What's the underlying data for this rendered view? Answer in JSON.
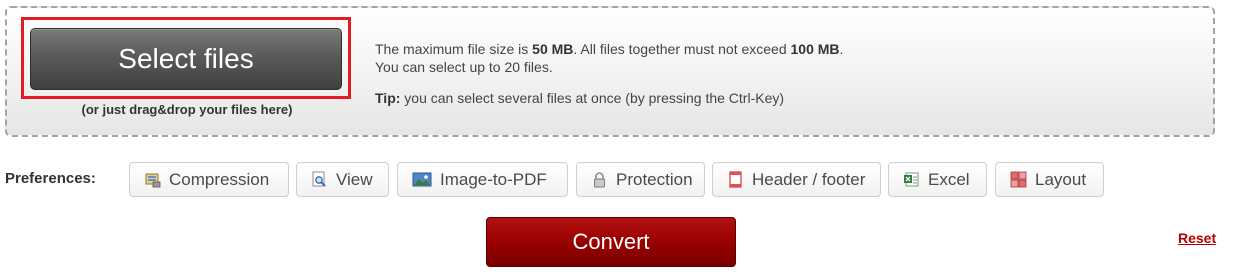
{
  "upload": {
    "select_label": "Select files",
    "drag_hint": "(or just drag&drop your files here)",
    "max_file_prefix": "The maximum file size is ",
    "max_file_value": "50 MB",
    "total_prefix": ". All files together must not exceed ",
    "total_value": "100 MB",
    "total_suffix": ".",
    "max_count_text": "You can select up to 20 files.",
    "tip_label": "Tip:",
    "tip_text": " you can select several files at once (by pressing the Ctrl-Key)"
  },
  "preferences": {
    "label": "Preferences:",
    "items": [
      {
        "label": "Compression",
        "icon": "compression-icon"
      },
      {
        "label": "View",
        "icon": "magnifier-icon"
      },
      {
        "label": "Image-to-PDF",
        "icon": "image-icon"
      },
      {
        "label": "Protection",
        "icon": "lock-icon"
      },
      {
        "label": "Header / footer",
        "icon": "document-icon"
      },
      {
        "label": "Excel",
        "icon": "excel-icon"
      },
      {
        "label": "Layout",
        "icon": "layout-grid-icon"
      }
    ]
  },
  "actions": {
    "convert_label": "Convert",
    "reset_label": "Reset"
  },
  "colors": {
    "highlight": "#e31b23",
    "convert": "#9a0000",
    "reset_link": "#b40000"
  }
}
